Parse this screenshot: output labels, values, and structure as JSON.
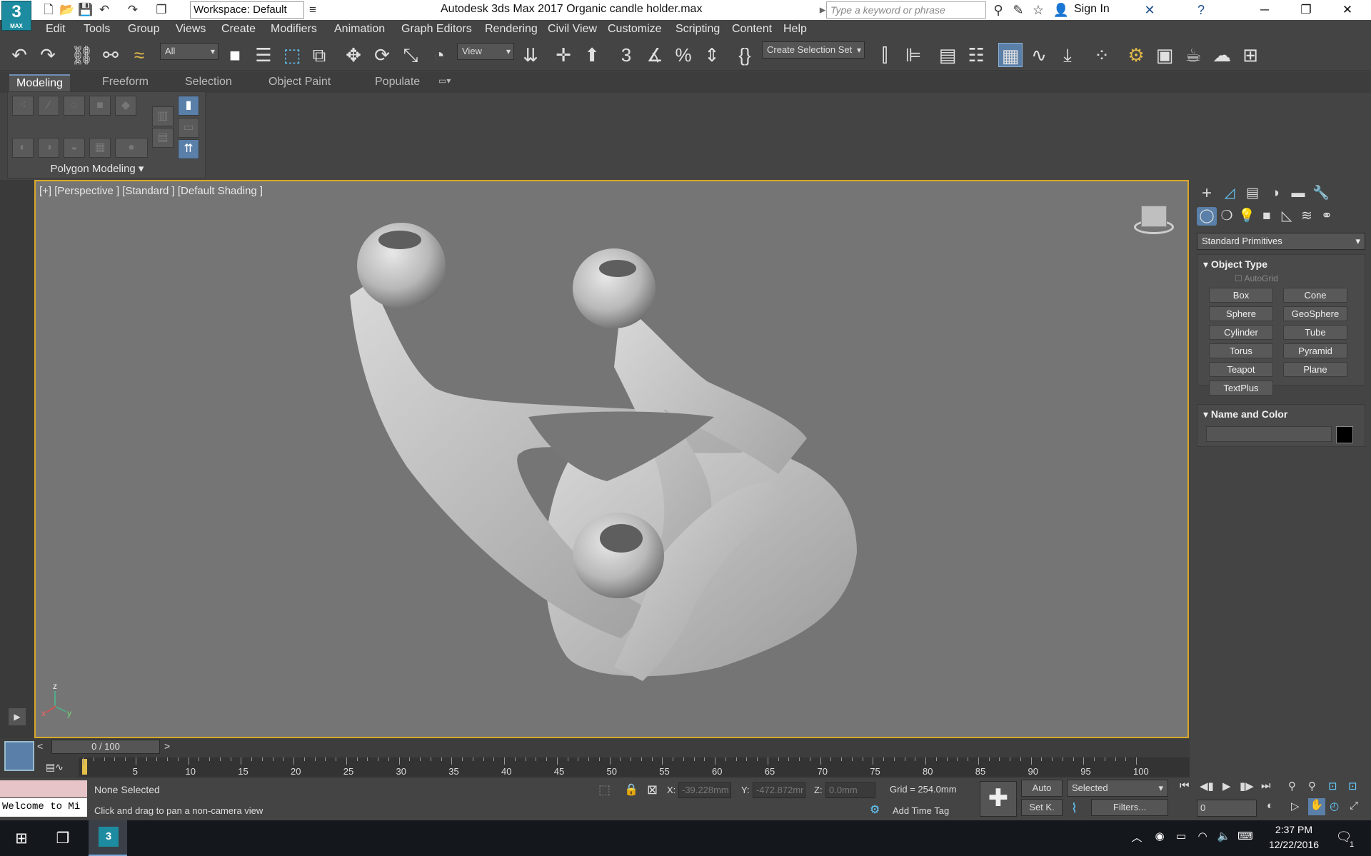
{
  "app": {
    "logo_text": "3",
    "logo_sub": "MAX",
    "workspace": "Workspace: Default",
    "title": "Autodesk 3ds Max 2017    Organic candle holder.max",
    "search_placeholder": "Type a keyword or phrase",
    "signin": "Sign In"
  },
  "menu": [
    "Edit",
    "Tools",
    "Group",
    "Views",
    "Create",
    "Modifiers",
    "Animation",
    "Graph Editors",
    "Rendering",
    "Civil View",
    "Customize",
    "Scripting",
    "Content",
    "Help"
  ],
  "toolbar": {
    "filter": "All",
    "refcoord": "View",
    "selection_set": "Create Selection Set"
  },
  "ribbon": {
    "tabs": [
      "Modeling",
      "Freeform",
      "Selection",
      "Object Paint",
      "Populate"
    ],
    "panel_label": "Polygon Modeling"
  },
  "viewport": {
    "label": "[+] [Perspective ] [Standard ] [Default Shading ]",
    "axis_x": "x",
    "axis_y": "y",
    "axis_z": "z"
  },
  "command_panel": {
    "category": "Standard Primitives",
    "object_type_title": "Object Type",
    "autogrid": "AutoGrid",
    "primitives": [
      "Box",
      "Cone",
      "Sphere",
      "GeoSphere",
      "Cylinder",
      "Tube",
      "Torus",
      "Pyramid",
      "Teapot",
      "Plane",
      "TextPlus"
    ],
    "name_color_title": "Name and Color",
    "object_color": "#000000"
  },
  "timeline": {
    "slider_text": "0 / 100",
    "prev": "<",
    "next": ">",
    "ticks": [
      "5",
      "10",
      "15",
      "20",
      "25",
      "30",
      "35",
      "40",
      "45",
      "50",
      "55",
      "60",
      "65",
      "70",
      "75",
      "80",
      "85",
      "90",
      "95",
      "100"
    ]
  },
  "status": {
    "selection": "None Selected",
    "prompt": "Click and drag to pan a non-camera view",
    "maxscript": "Welcome to Mi",
    "x_label": "X:",
    "x_value": "-39.228mm",
    "y_label": "Y:",
    "y_value": "-472.872mr",
    "z_label": "Z:",
    "z_value": "0.0mm",
    "grid": "Grid = 254.0mm",
    "add_time_tag": "Add Time Tag",
    "auto": "Auto",
    "set_key": "Set K.",
    "key_filter": "Selected",
    "filters": "Filters...",
    "frame": "0"
  },
  "taskbar": {
    "time": "2:37 PM",
    "date": "12/22/2016",
    "notif_count": "1"
  }
}
